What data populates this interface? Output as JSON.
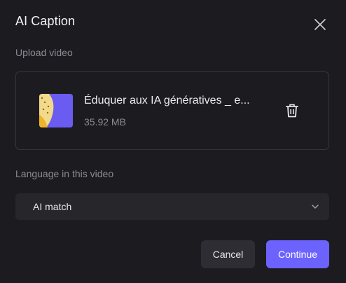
{
  "dialog": {
    "title": "AI Caption"
  },
  "upload": {
    "label": "Upload video",
    "file_name": "Éduquer aux IA génératives _ e...",
    "file_size": "35.92 MB"
  },
  "language": {
    "label": "Language in this video",
    "selected": "AI match"
  },
  "actions": {
    "cancel_label": "Cancel",
    "continue_label": "Continue"
  },
  "colors": {
    "accent": "#6c63ff",
    "background": "#1c1c20",
    "thumbnail": "#6a5cf0"
  },
  "icons": {
    "close": "close-icon",
    "delete": "trash-icon",
    "dropdown": "chevron-down-icon"
  }
}
